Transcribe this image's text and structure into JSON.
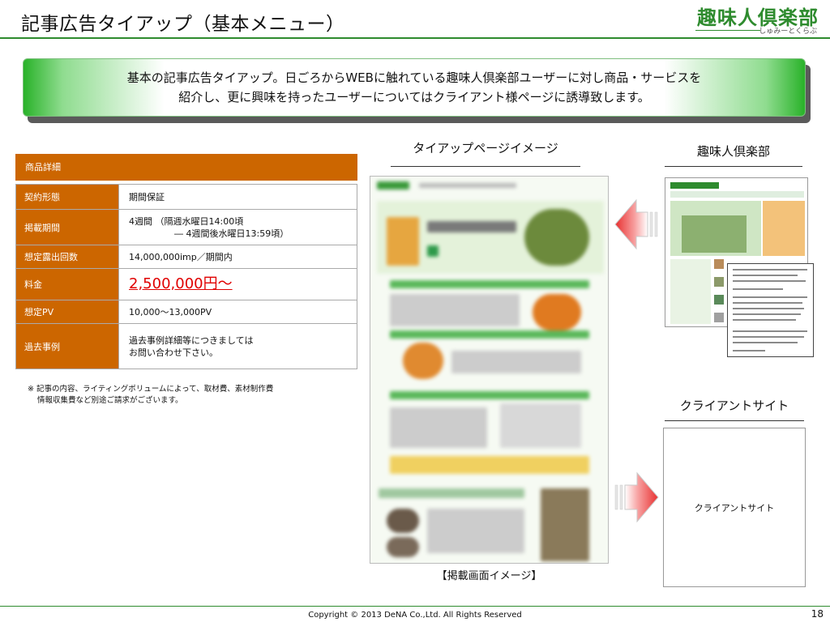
{
  "title": "記事広告タイアップ（基本メニュー）",
  "logo": {
    "name": "趣味人倶楽部",
    "reading": "しゅみーとくらぶ"
  },
  "banner": {
    "line1": "基本の記事広告タイアップ。日ごろからWEBに触れている趣味人倶楽部ユーザーに対し商品・サービスを",
    "line2": "紹介し、更に興味を持ったユーザーについてはクライアント様ページに誘導致します。"
  },
  "table": {
    "header": "商品詳細",
    "rows": [
      {
        "key": "契約形態",
        "value": "期間保証"
      },
      {
        "key": "掲載期間",
        "line1": "4週間 （隔週水曜日14:00頃",
        "line2": "― 4週間後水曜日13:59頃）"
      },
      {
        "key": "想定露出回数",
        "value": "14,000,000imp／期間内"
      },
      {
        "key": "料金",
        "value": "2,500,000円～"
      },
      {
        "key": "想定PV",
        "value": "10,000～13,000PV"
      },
      {
        "key": "過去事例",
        "line1": "過去事例詳細等につきましては",
        "line2": "お問い合わせ下さい。"
      }
    ]
  },
  "note": {
    "line1": "※ 記事の内容、ライティングボリュームによって、取材費、素材制作費",
    "line2": "情報収集費など別途ご請求がございます。"
  },
  "columns": {
    "tieup_label": "タイアップページイメージ",
    "shumi_label": "趣味人倶楽部",
    "client_label": "クライアントサイト",
    "client_box_text": "クライアントサイト",
    "caption": "【掲載画面イメージ】"
  },
  "colors": {
    "accent_orange": "#cc6600",
    "brand_green": "#2e8b2e",
    "price_red": "#e00000",
    "arrow_red": "#e83030"
  },
  "footer": {
    "copyright": "Copyright © 2013 DeNA Co.,Ltd. All Rights Reserved",
    "page": "18"
  }
}
